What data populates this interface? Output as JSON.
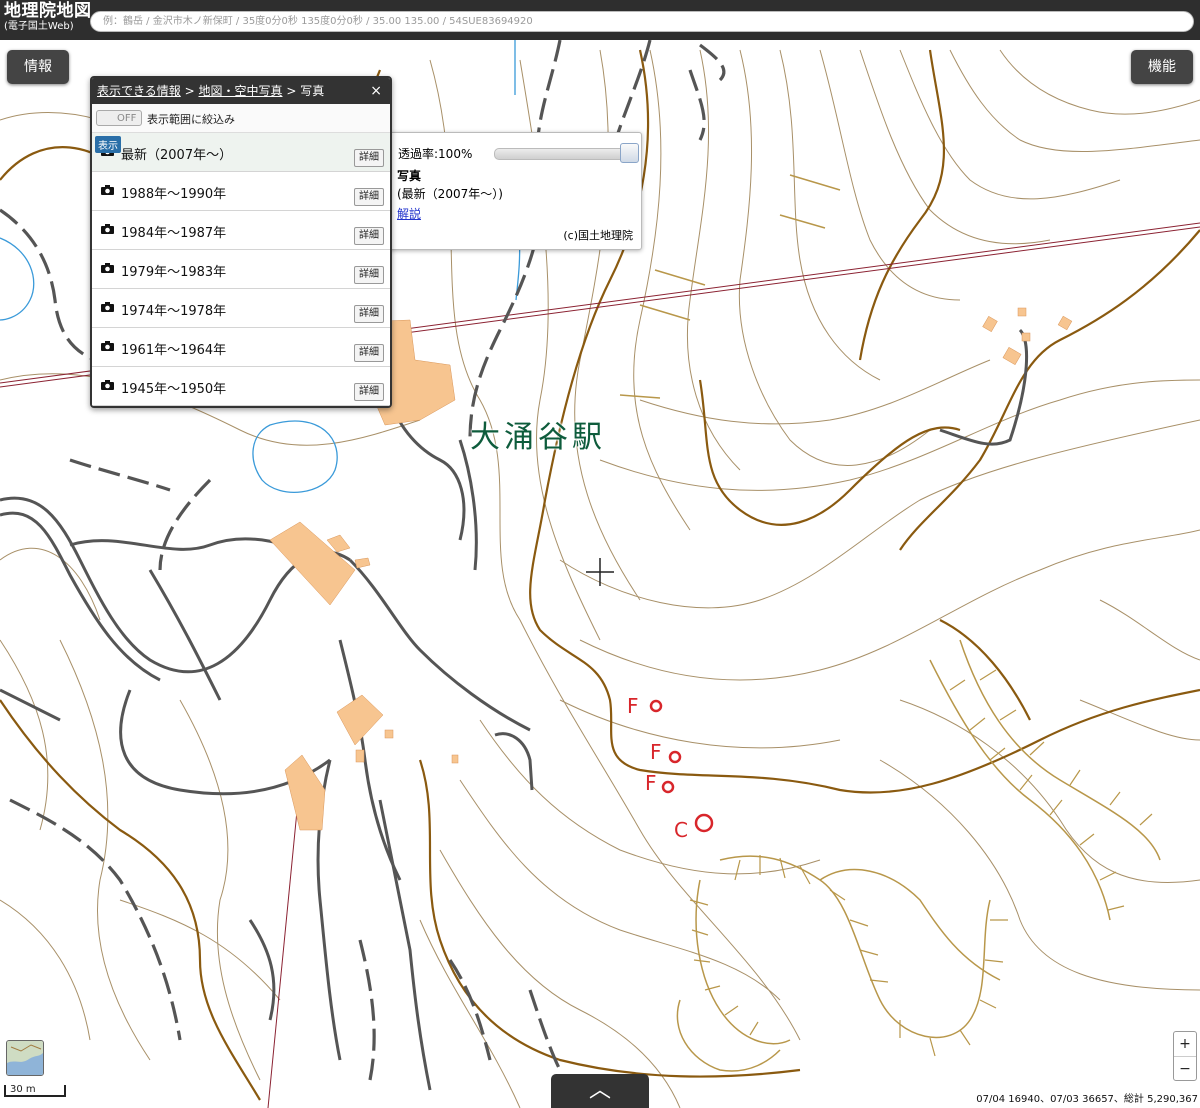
{
  "header": {
    "logo_line1": "地理院地図",
    "logo_line2": "(電子国土Web)",
    "search_placeholder": "例：鶴岳 / 金沢市木ノ新保町 / 35度0分0秒 135度0分0秒 / 35.00 135.00 / 54SUE83694920"
  },
  "buttons": {
    "info": "情報",
    "functions": "機能"
  },
  "layer_panel": {
    "breadcrumb": [
      "表示できる情報",
      "地図・空中写真",
      "写真"
    ],
    "separator": ">",
    "close": "×",
    "filter_toggle": "OFF",
    "filter_label": "表示範囲に絞込み",
    "shown_badge": "表示",
    "detail_label": "詳細",
    "items": [
      {
        "label": "最新（2007年〜）"
      },
      {
        "label": "1988年〜1990年"
      },
      {
        "label": "1984年〜1987年"
      },
      {
        "label": "1979年〜1983年"
      },
      {
        "label": "1974年〜1978年"
      },
      {
        "label": "1961年〜1964年"
      },
      {
        "label": "1945年〜1950年"
      }
    ]
  },
  "opacity_popup": {
    "transparency": "透過率:100%",
    "transparency_value": 100,
    "title": "写真",
    "name": "(最新（2007年〜）)",
    "link": "解説",
    "credit": "(c)国土地理院"
  },
  "map": {
    "station_label": "大涌谷駅",
    "markers": [
      "F",
      "F",
      "F",
      "C"
    ],
    "colors": {
      "contour": "#a89068",
      "index_contour": "#8a5a10",
      "road": "#555555",
      "water": "#3a9ad9",
      "building": "#f7c590",
      "marker": "#d8262b",
      "ropeway": "#8b2232"
    }
  },
  "footer": {
    "scale": "30 m",
    "expand": "︿",
    "zoom_in": "+",
    "zoom_out": "−",
    "coords": "07/04 16940、07/03 36657、総計 5,290,367"
  }
}
